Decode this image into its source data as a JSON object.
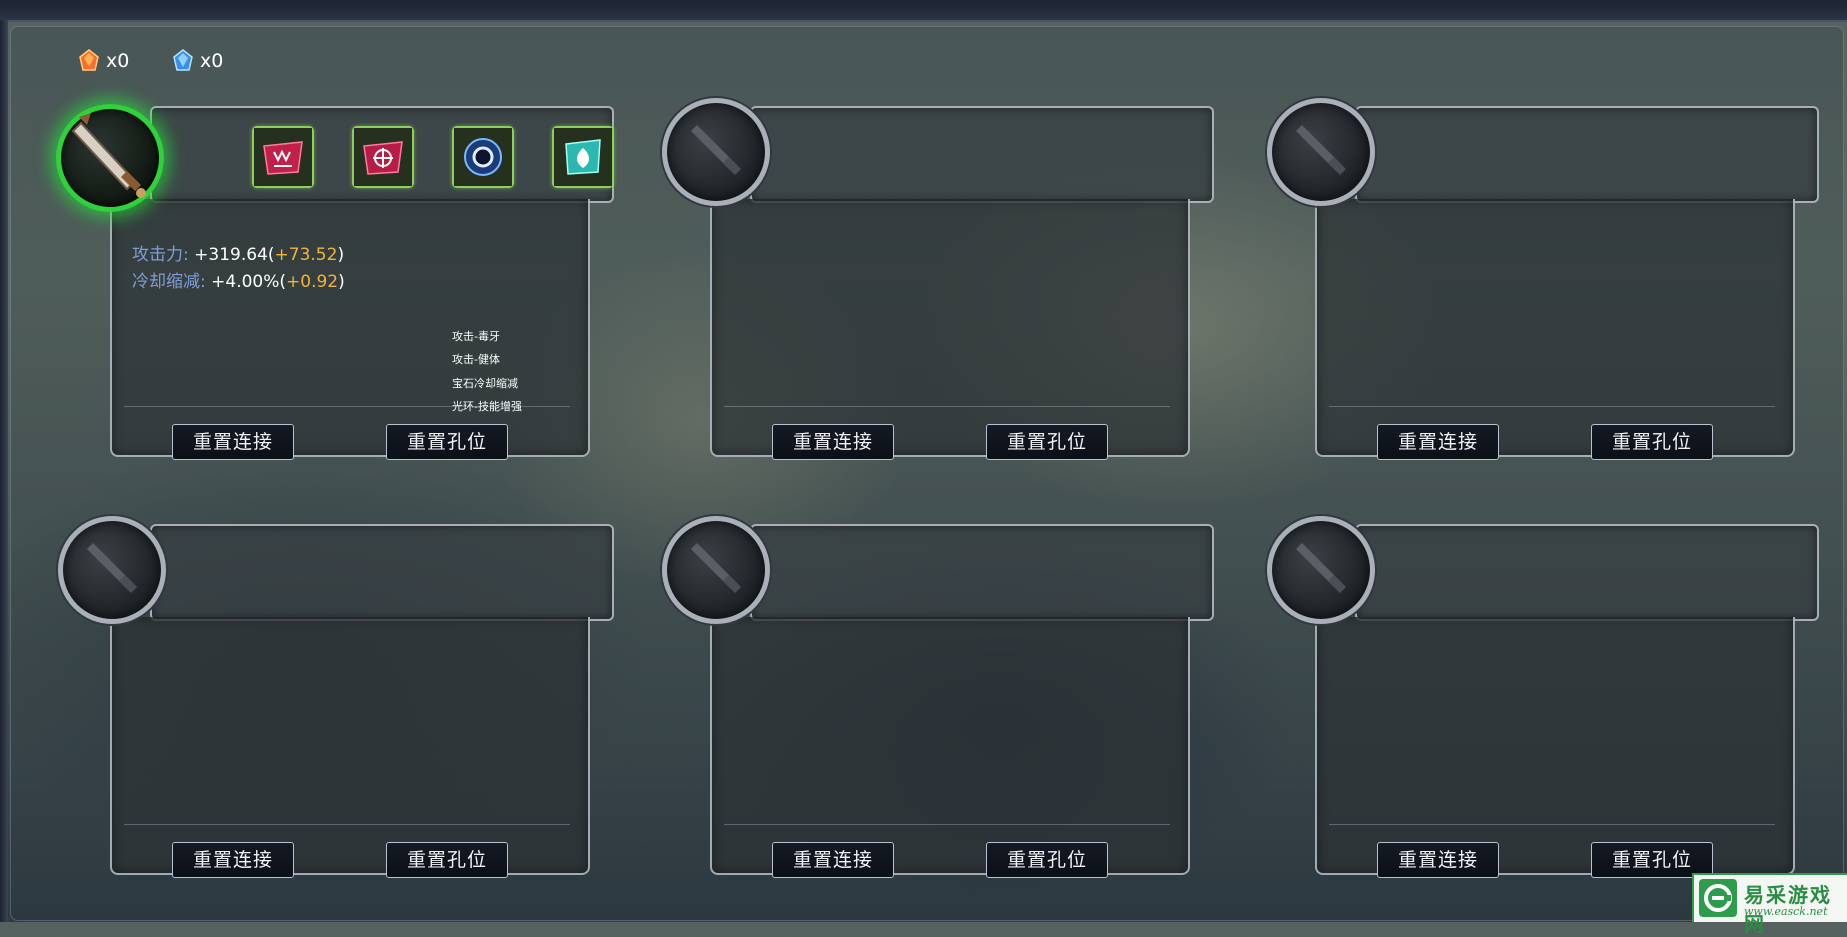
{
  "currency": [
    {
      "name": "red-gem",
      "count": "x0",
      "color": "#ff6a2a"
    },
    {
      "name": "blue-gem",
      "count": "x0",
      "color": "#4aa8ff"
    }
  ],
  "buttons": {
    "reset_link": "重置连接",
    "reset_hole": "重置孔位"
  },
  "panels": [
    {
      "equipped": true,
      "item_icon": "sword-icon",
      "skills": [
        {
          "name": "venom-fang-skill-icon",
          "color": "#c0204a"
        },
        {
          "name": "vigor-skill-icon",
          "color": "#c0204a"
        },
        {
          "name": "gem-cooldown-skill-icon",
          "color": "#2a5aa8"
        },
        {
          "name": "aura-skill-icon",
          "color": "#2ab8b0"
        }
      ],
      "stats": [
        {
          "label": "攻击力:",
          "value": "+319.64(",
          "bonus": "+73.52",
          "close": ")"
        },
        {
          "label": "冷却缩减:",
          "value": "+4.00%(",
          "bonus": "+0.92",
          "close": ")"
        }
      ],
      "skill_list": [
        "攻击-毒牙",
        "攻击-健体",
        "宝石冷却缩减",
        "光环-技能增强"
      ]
    },
    {
      "equipped": false
    },
    {
      "equipped": false
    },
    {
      "equipped": false
    },
    {
      "equipped": false
    },
    {
      "equipped": false
    }
  ],
  "watermark": {
    "title": "易采游戏网",
    "url": "www.easck.net"
  }
}
